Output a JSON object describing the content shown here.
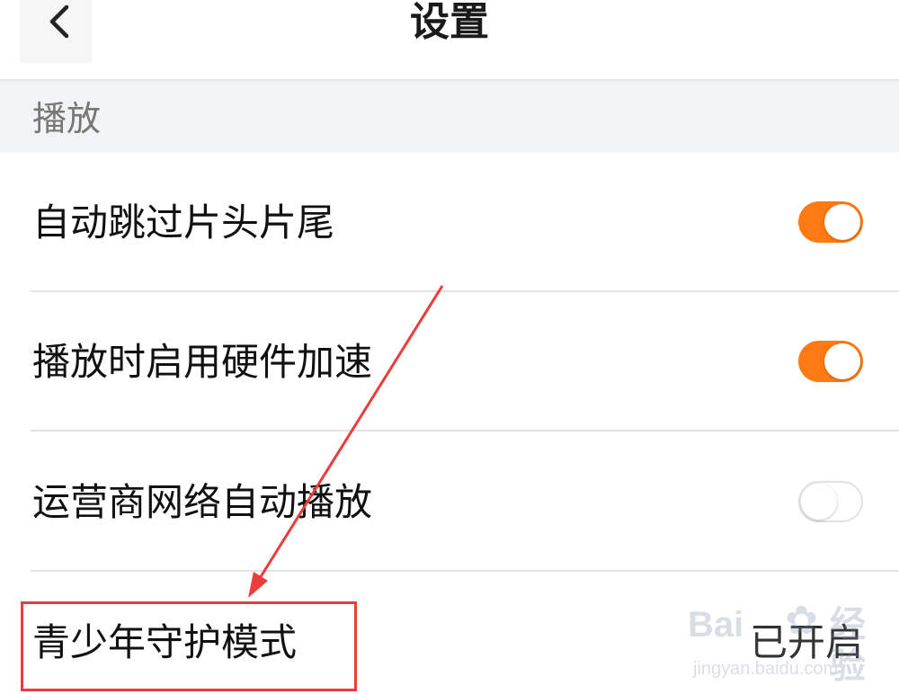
{
  "header": {
    "title": "设置",
    "back_icon": "chevron-left-icon"
  },
  "section": {
    "label": "播放"
  },
  "settings": [
    {
      "label": "自动跳过片头片尾",
      "control": "toggle",
      "enabled": true
    },
    {
      "label": "播放时启用硬件加速",
      "control": "toggle",
      "enabled": true
    },
    {
      "label": "运营商网络自动播放",
      "control": "toggle",
      "enabled": false
    },
    {
      "label": "青少年守护模式",
      "control": "value",
      "value": "已开启"
    }
  ],
  "colors": {
    "toggle_on": "#ff7a12",
    "annotation": "#ee3b3b"
  },
  "annotation": {
    "type": "red-arrow-and-box",
    "target": "青少年守护模式"
  },
  "watermark": {
    "logo": "Bai",
    "logo_suffix": "经验",
    "url": "jingyan.baidu.com"
  }
}
